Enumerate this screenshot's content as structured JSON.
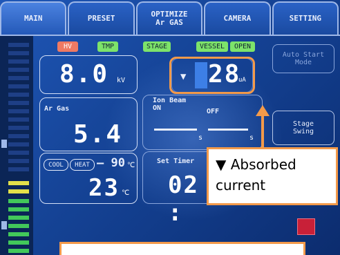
{
  "tabs": [
    {
      "label": "MAIN",
      "active": true
    },
    {
      "label": "PRESET",
      "active": false
    },
    {
      "label": "OPTIMIZE\nAr GAS",
      "active": false
    },
    {
      "label": "CAMERA",
      "active": false
    },
    {
      "label": "SETTING",
      "active": false
    }
  ],
  "status_chips": {
    "hv": "HV",
    "tmp": "TMP",
    "stage": "STAGE",
    "vessel": "VESSEL",
    "open": "OPEN"
  },
  "accelerating_voltage": {
    "value": "8.0",
    "unit": "kV"
  },
  "absorbed_current": {
    "arrow": "▼",
    "value": "28",
    "unit": "uA"
  },
  "ar_gas": {
    "label": "Ar Gas",
    "value": "5.4"
  },
  "ion_beam": {
    "label": "Ion Beam",
    "on_label": "ON",
    "off_label": "OFF",
    "unit_s": "s"
  },
  "temperature": {
    "cool": "COOL",
    "heat": "HEAT",
    "setpoint": "– 90",
    "setpoint_unit": "℃",
    "value": "23",
    "unit": "℃"
  },
  "timer": {
    "label": "Set Timer",
    "value": "02 :"
  },
  "side_buttons": {
    "auto_start": "Auto Start\nMode",
    "stage_swing": "Stage\nSwing"
  },
  "callout": {
    "arrow": "▼",
    "line1": "Absorbed",
    "line2": "current"
  },
  "colors": {
    "annotation": "#f39a4a",
    "screen_bg": "#1a4aa0",
    "chip_hv": "#ef7a63",
    "chip_green": "#7de36a"
  }
}
